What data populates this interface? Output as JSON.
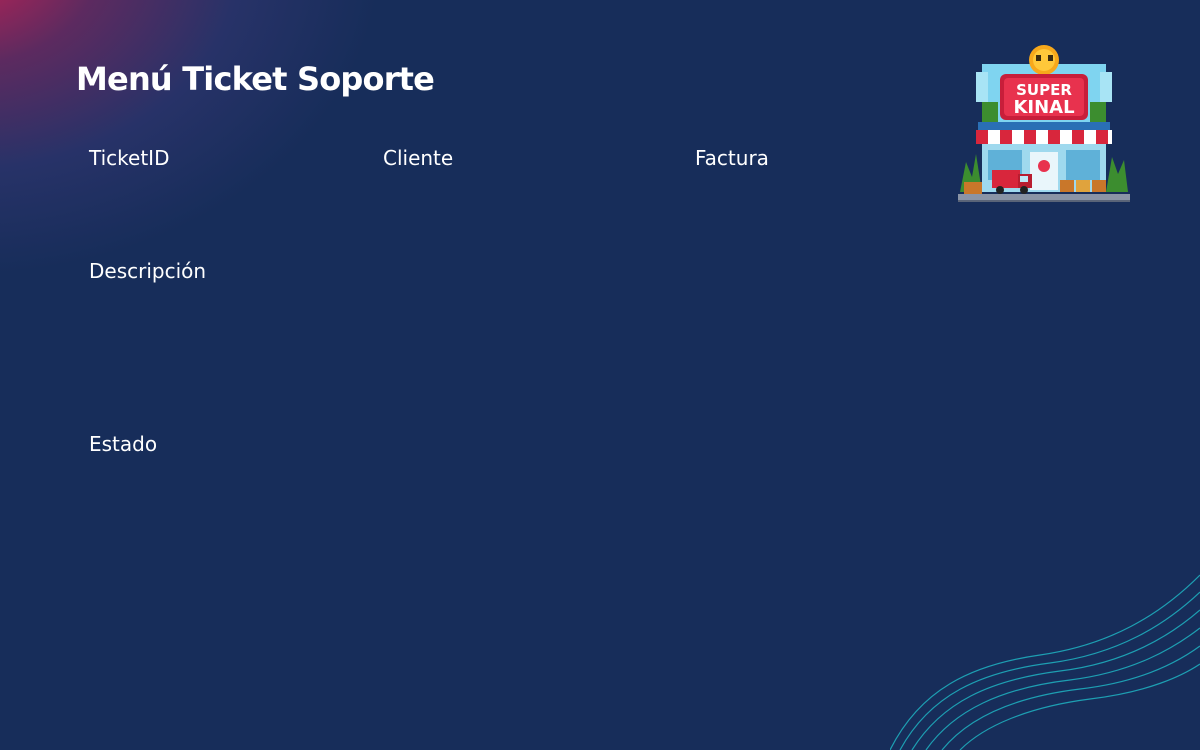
{
  "page": {
    "title": "Menú Ticket Soporte"
  },
  "form": {
    "labels": {
      "ticket_id": "TicketID",
      "cliente": "Cliente",
      "factura": "Factura",
      "descripcion": "Descripción",
      "estado": "Estado"
    }
  },
  "logo": {
    "line1": "SUPER",
    "line2": "KINAL",
    "icon": "store-pixel-logo"
  },
  "colors": {
    "background": "#172d5a",
    "glow": "#d22052",
    "wave": "#1fb3c2",
    "text": "#ffffff"
  }
}
